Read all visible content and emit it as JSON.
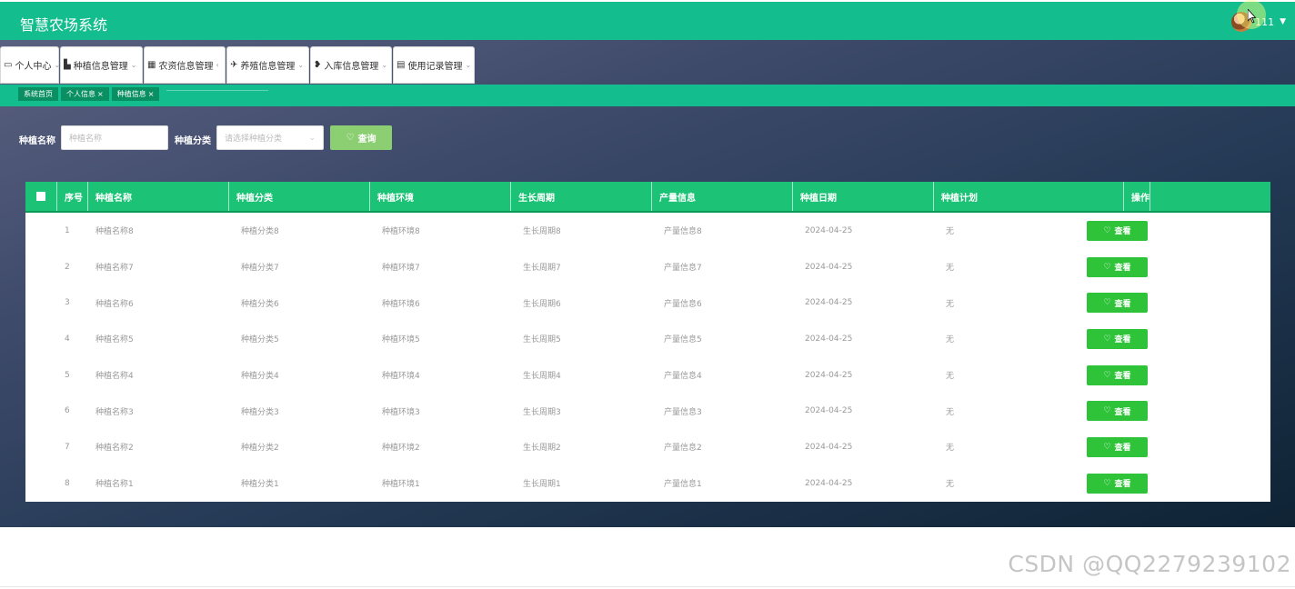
{
  "app": {
    "title": "智慧农场系统"
  },
  "user": {
    "name": "111",
    "caret": "▼"
  },
  "menu": [
    {
      "icon": "▭",
      "icon_name": "user-card-icon",
      "label": "个人中心",
      "arrow": "⌄"
    },
    {
      "icon": "▙",
      "icon_name": "briefcase-icon",
      "label": "种植信息管理",
      "arrow": "⌄"
    },
    {
      "icon": "▦",
      "icon_name": "grid-icon",
      "label": "农资信息管理",
      "arrow": "‹"
    },
    {
      "icon": "✈",
      "icon_name": "paper-plane-icon",
      "label": "养殖信息管理",
      "arrow": "⌄"
    },
    {
      "icon": "❥",
      "icon_name": "location-pin-icon",
      "label": "入库信息管理",
      "arrow": "⌄"
    },
    {
      "icon": "▤",
      "icon_name": "clipboard-icon",
      "label": "使用记录管理",
      "arrow": "⌄"
    }
  ],
  "tabs": [
    {
      "label": "系统首页",
      "close": ""
    },
    {
      "label": "个人信息",
      "close": "×"
    },
    {
      "label": "种植信息",
      "close": "×"
    }
  ],
  "filters": {
    "name_label": "种植名称",
    "name_placeholder": "种植名称",
    "category_label": "种植分类",
    "category_placeholder": "请选择种植分类",
    "query_button": "查询",
    "query_icon": "♡"
  },
  "table": {
    "columns": [
      "序号",
      "种植名称",
      "种植分类",
      "种植环境",
      "生长周期",
      "产量信息",
      "种植日期",
      "种植计划",
      "操作"
    ],
    "action_label": "查看",
    "action_icon": "♡",
    "rows": [
      [
        "1",
        "种植名称8",
        "种植分类8",
        "种植环境8",
        "生长周期8",
        "产量信息8",
        "2024-04-25",
        "无"
      ],
      [
        "2",
        "种植名称7",
        "种植分类7",
        "种植环境7",
        "生长周期7",
        "产量信息7",
        "2024-04-25",
        "无"
      ],
      [
        "3",
        "种植名称6",
        "种植分类6",
        "种植环境6",
        "生长周期6",
        "产量信息6",
        "2024-04-25",
        "无"
      ],
      [
        "4",
        "种植名称5",
        "种植分类5",
        "种植环境5",
        "生长周期5",
        "产量信息5",
        "2024-04-25",
        "无"
      ],
      [
        "5",
        "种植名称4",
        "种植分类4",
        "种植环境4",
        "生长周期4",
        "产量信息4",
        "2024-04-25",
        "无"
      ],
      [
        "6",
        "种植名称3",
        "种植分类3",
        "种植环境3",
        "生长周期3",
        "产量信息3",
        "2024-04-25",
        "无"
      ],
      [
        "7",
        "种植名称2",
        "种植分类2",
        "种植环境2",
        "生长周期2",
        "产量信息2",
        "2024-04-25",
        "无"
      ],
      [
        "8",
        "种植名称1",
        "种植分类1",
        "种植环境1",
        "生长周期1",
        "产量信息1",
        "2024-04-25",
        "无"
      ]
    ]
  },
  "watermark": "CSDN @QQ2279239102",
  "colors": {
    "header": "#13bd8e",
    "table_header": "#1cc275",
    "view_button": "#2fc33a",
    "query_button": "#8ccf72",
    "tab": "#0a8f63"
  }
}
